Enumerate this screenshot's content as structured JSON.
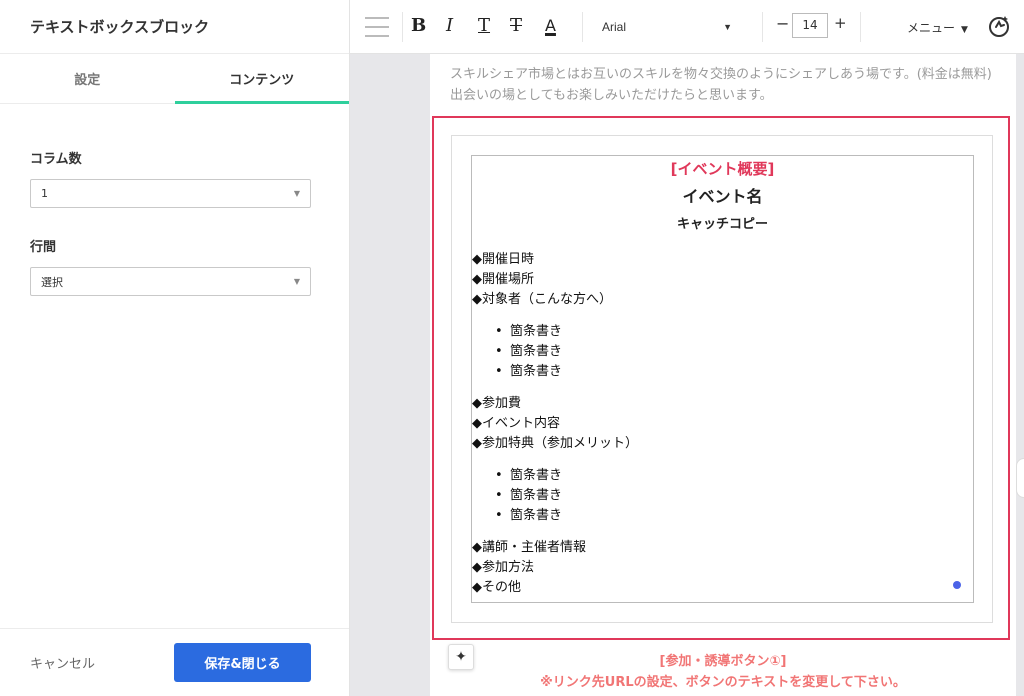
{
  "panel": {
    "title": "テキストボックスブロック",
    "tabs": [
      {
        "label": "設定"
      },
      {
        "label": "コンテンツ"
      }
    ],
    "columns_label": "コラム数",
    "columns_value": "1",
    "line_spacing_label": "行間",
    "line_spacing_value": "選択",
    "cancel_label": "キャンセル",
    "save_label": "保存&閉じる"
  },
  "toolbar": {
    "bold": "B",
    "italic": "I",
    "underline": "T",
    "strike": "T",
    "font_color": "A",
    "font_name": "Arial",
    "minus": "−",
    "font_size": "14",
    "plus": "+",
    "menu_label": "メニュー"
  },
  "content": {
    "intro": "スキルシェア市場とはお互いのスキルを物々交換のようにシェアしあう場です。(料金は無料) 出会いの場としてもお楽しみいただけたらと思います。",
    "event_kind": "[イベント概要]",
    "event_name": "イベント名",
    "catch_copy": "キャッチコピー",
    "group1": [
      "◆開催日時",
      "◆開催場所",
      "◆対象者（こんな方へ）"
    ],
    "bullets1": [
      "箇条書き",
      "箇条書き",
      "箇条書き"
    ],
    "group2": [
      "◆参加費",
      "◆イベント内容",
      "◆参加特典（参加メリット）"
    ],
    "bullets2": [
      "箇条書き",
      "箇条書き",
      "箇条書き"
    ],
    "group3": [
      "◆講師・主催者情報",
      "◆参加方法",
      "◆その他"
    ],
    "cta_title": "[参加・誘導ボタン①]",
    "cta_note": "※リンク先URLの設定、ボタンのテキストを変更して下さい。"
  },
  "colors": {
    "accent": "#2fcf9c",
    "primary_button": "#2b6be0",
    "selection_border": "#e0385a",
    "event_kind": "#e0385a",
    "cta_text": "#f17575"
  },
  "icons": {
    "hamburger": "drag-handle-icon",
    "ai": "ai-assist-icon",
    "sparkle": "sparkle-icon"
  }
}
